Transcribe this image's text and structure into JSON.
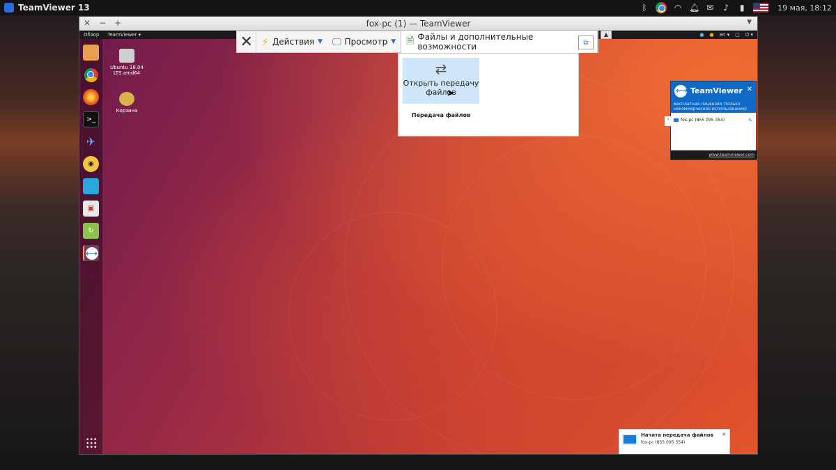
{
  "host_panel": {
    "app_name": "TeamViewer 13",
    "clock": "19 мая, 18:12"
  },
  "window": {
    "title": "fox-pc (1) — TeamViewer"
  },
  "remote_panel": {
    "overview": "Обзор",
    "app_menu": "TeamViewer ▾",
    "lang": "en ▾"
  },
  "desktop_icons": [
    {
      "label": "Ubuntu 18.04 LTS amd64"
    },
    {
      "label": "Корзина"
    }
  ],
  "toolbar": {
    "actions_label": "Действия",
    "view_label": "Просмотр",
    "files_label": "Файлы и дополнительные возможности"
  },
  "dropdown": {
    "item_label": "Открыть передачу файлов",
    "group_label": "Передача файлов"
  },
  "tv_panel": {
    "brand": "TeamViewer",
    "license": "Бесплатная лицензия (только некоммерческое использование)",
    "partner": "fox-pc (855 095 354)",
    "footer_link": "www.teamviewer.com"
  },
  "notification": {
    "title": "Начата передача файлов",
    "text": "fox-pc (855 095 354)"
  },
  "colors": {
    "teamviewer_blue": "#0e6ac5",
    "wallpaper_orange": "#e7582b",
    "wallpaper_purple": "#6e1a4c"
  }
}
